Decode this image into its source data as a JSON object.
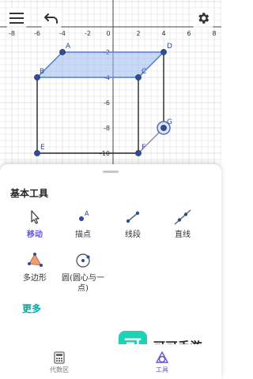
{
  "graph": {
    "x_ticks": [
      "-8",
      "-6",
      "-4",
      "-2",
      "0",
      "2",
      "4",
      "6",
      "8"
    ],
    "y_ticks": [
      "-2",
      "-4",
      "-6",
      "-8",
      "-10"
    ],
    "points": [
      {
        "label": "A",
        "x": -4,
        "y": -2
      },
      {
        "label": "B",
        "x": -6,
        "y": -4
      },
      {
        "label": "C",
        "x": 2,
        "y": -4
      },
      {
        "label": "D",
        "x": 4,
        "y": -2
      },
      {
        "label": "E",
        "x": -6,
        "y": -10
      },
      {
        "label": "F",
        "x": 2,
        "y": -10
      },
      {
        "label": "G",
        "x": 4,
        "y": -8
      }
    ],
    "selected_point": "G",
    "colors": {
      "grid": "#e6e6e6",
      "axis": "#444444",
      "point": "#2f4c96",
      "polygon_fill": "#9bbaf0",
      "polygon_stroke": "#4a7fd8",
      "edge": "#222222",
      "segment_fg": "#8e8aa8"
    }
  },
  "toolbar": {
    "menu_icon": "hamburger-menu-icon",
    "undo_icon": "undo-icon",
    "settings_icon": "gear-icon"
  },
  "panel": {
    "title": "基本工具",
    "tools": [
      {
        "id": "move",
        "label": "移动",
        "icon": "cursor-arrow-icon",
        "selected": true
      },
      {
        "id": "point",
        "label": "描点",
        "icon": "point-icon"
      },
      {
        "id": "segment",
        "label": "线段",
        "icon": "segment-icon"
      },
      {
        "id": "line",
        "label": "直线",
        "icon": "line-icon"
      },
      {
        "id": "polygon",
        "label": "多边形",
        "icon": "polygon-icon"
      },
      {
        "id": "circle",
        "label": "圆(圆心与一点)",
        "icon": "circle-center-point-icon"
      }
    ],
    "more_label": "更多"
  },
  "bottom_nav": {
    "algebra_label": "代数区",
    "tools_label": "工具"
  },
  "watermark": {
    "logo_char": "可",
    "text": "可可手游"
  },
  "accent_color": "#6557d2"
}
